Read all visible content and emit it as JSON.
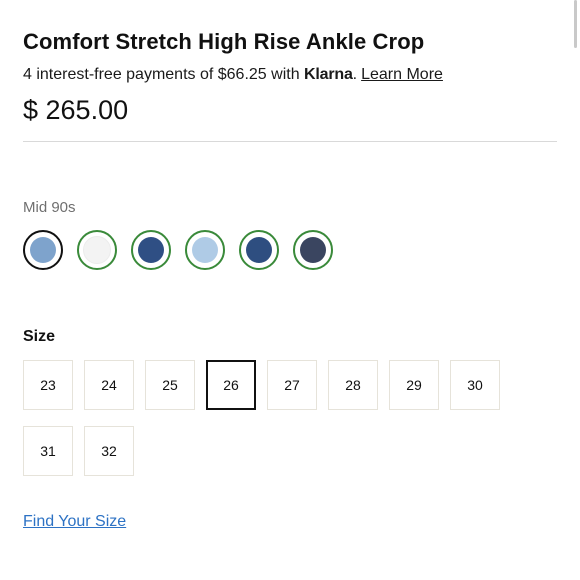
{
  "product": {
    "title": "Comfort Stretch High Rise Ankle Crop",
    "price": "$ 265.00"
  },
  "klarna": {
    "text": "4 interest-free payments of $66.25 with ",
    "brand": "Klarna",
    "period": ".",
    "learn_more": "Learn More"
  },
  "color": {
    "selected_name": "Mid 90s",
    "swatches": [
      {
        "hex": "#7ea3cc",
        "selected": true
      },
      {
        "hex": "#f3f3f3",
        "selected": false
      },
      {
        "hex": "#2f4f84",
        "selected": false
      },
      {
        "hex": "#afcbe6",
        "selected": false
      },
      {
        "hex": "#2e4e80",
        "selected": false
      },
      {
        "hex": "#3a4560",
        "selected": false
      }
    ]
  },
  "size": {
    "label": "Size",
    "options": [
      "23",
      "24",
      "25",
      "26",
      "27",
      "28",
      "29",
      "30",
      "31",
      "32"
    ],
    "selected": "26"
  },
  "find_size": "Find Your Size"
}
